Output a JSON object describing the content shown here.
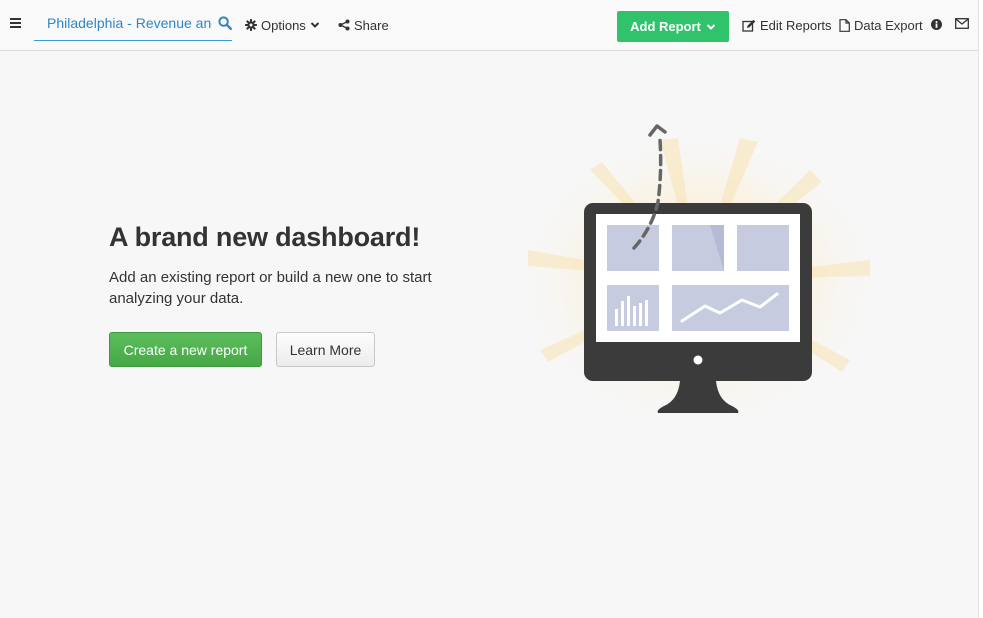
{
  "header": {
    "dashboard_title": "Philadelphia - Revenue and",
    "options_label": "Options",
    "share_label": "Share",
    "add_report_label": "Add Report",
    "edit_reports_label": "Edit Reports",
    "data_export_label": "Data Export"
  },
  "hero": {
    "title": "A brand new dashboard!",
    "description": "Add an existing report or build a new one to start analyzing your data.",
    "create_button_label": "Create a new report",
    "learn_more_label": "Learn More"
  },
  "icons": {
    "menu": "hamburger-icon",
    "search": "search-icon",
    "options": "gear-icon",
    "share": "share-icon",
    "edit": "edit-icon",
    "export": "file-icon",
    "info": "info-icon",
    "mail": "envelope-icon"
  },
  "colors": {
    "accent_blue": "#2f86c4",
    "add_report_green": "#31c26c",
    "create_button_green": "#4caf50",
    "monitor_dark": "#3b3b3b",
    "panel_blue": "#c6cbe0"
  }
}
